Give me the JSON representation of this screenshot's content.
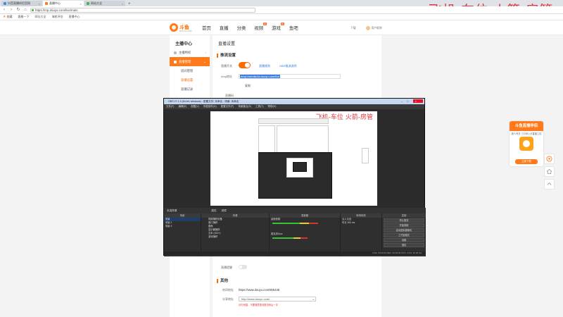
{
  "browser": {
    "tabs": [
      {
        "label": "抖音直播伴侣官网",
        "active": false
      },
      {
        "label": "直播中心",
        "active": true
      },
      {
        "label": "网站大全",
        "active": false
      }
    ],
    "url": "https://mp.douyu.com/live/main",
    "bookmarks": [
      "收藏",
      "跟着一下",
      "网址大全",
      "海航评估",
      "直播中心"
    ]
  },
  "overlay": {
    "title": "飞机-车位 火箭-房管",
    "subtitle": "新人 三分钟上手"
  },
  "site": {
    "logo_text": "斗鱼",
    "logo_sub": "DOUYU.COM",
    "nav": [
      "首页",
      "直播",
      "分类",
      "视频",
      "游戏",
      "鱼吧"
    ],
    "nav_badges": {
      "视频": "新",
      "游戏": "热"
    },
    "header_right": [
      "下载",
      "用户昵称"
    ]
  },
  "sidebar": {
    "title": "主播中心",
    "items": [
      {
        "label": "主播特权",
        "type": "group"
      },
      {
        "label": "直播管理",
        "type": "active-group"
      },
      {
        "label": "房间管理",
        "type": "sub"
      },
      {
        "label": "直播设置",
        "type": "current"
      },
      {
        "label": "直播记录",
        "type": "sub"
      }
    ]
  },
  "main": {
    "page_title": "直播设置",
    "section1": "推流设置",
    "live_switch_label": "直播开关",
    "link1": "直播规则",
    "link2": "OBS推流说明",
    "rtmp_label": "rtmp地址",
    "rtmp_value": "rtmp://sendtc3a.douyu.com/live",
    "copy_label": "复制",
    "code_label": "直播码",
    "lower_switch_label": "直播提醒",
    "section2": "其他",
    "room_label": "房间地址",
    "room_url": "https://www.douyu.com/905448",
    "share_label": "分享地址",
    "share_url": "http://www.douyu.com/...",
    "warning": "请勿泄露，不要随意更改推流码后一字"
  },
  "obs": {
    "title": "OBS 27.1.3 (64-bit, windows) - 配置文件: 未命名 - 场景: 未命名",
    "menu": [
      "文件(F)",
      "编辑(E)",
      "视图(V)",
      "停靠部件(D)",
      "配置文件(P)",
      "场景集合(S)",
      "工具(T)",
      "帮助(H)"
    ],
    "preview_title": "飞机-车位 火箭-房管",
    "bar_text": "未选择源",
    "bar_props": "属性",
    "bar_filters": "滤镜",
    "docks": {
      "scenes": {
        "title": "场景",
        "items": [
          "场景",
          "场景 2",
          "场景 3"
        ]
      },
      "sources": {
        "title": "来源",
        "items": [
          "视频捕获设备",
          "窗口捕获",
          "图像",
          "显示器捕获",
          "文本 (GDI+)",
          "游戏捕获"
        ]
      },
      "mixer": {
        "title": "混音器",
        "items": [
          "桌面音频",
          "麦克风/Aux"
        ],
        "levels": [
          0.72,
          0.55
        ]
      },
      "transitions": {
        "title": "转场特效",
        "value": "淡入淡出",
        "duration_label": "时长",
        "duration": "300 ms"
      },
      "controls": {
        "title": "控制",
        "buttons": [
          "停止推流",
          "开始录制",
          "启动虚拟摄像机",
          "工作室模式",
          "设置",
          "退出"
        ]
      }
    },
    "status": "LIVE: 00:00:26  REC: 00:00:00  CPU: 4.0%, 30.00 fps"
  },
  "ad": {
    "title": "斗鱼直播伴侣",
    "sub": "新人专享 三分钟上手直播工具",
    "btn": "立即下载"
  }
}
